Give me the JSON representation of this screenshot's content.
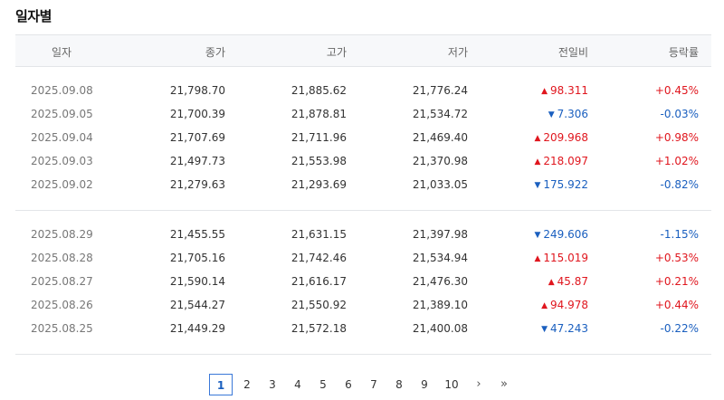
{
  "title": "일자별",
  "headers": [
    "일자",
    "종가",
    "고가",
    "저가",
    "전일비",
    "등락률"
  ],
  "groups": [
    [
      {
        "date": "2025.09.08",
        "close": "21,798.70",
        "high": "21,885.62",
        "low": "21,776.24",
        "change": "98.311",
        "dir": "up",
        "rate": "+0.45%"
      },
      {
        "date": "2025.09.05",
        "close": "21,700.39",
        "high": "21,878.81",
        "low": "21,534.72",
        "change": "7.306",
        "dir": "down",
        "rate": "-0.03%"
      },
      {
        "date": "2025.09.04",
        "close": "21,707.69",
        "high": "21,711.96",
        "low": "21,469.40",
        "change": "209.968",
        "dir": "up",
        "rate": "+0.98%"
      },
      {
        "date": "2025.09.03",
        "close": "21,497.73",
        "high": "21,553.98",
        "low": "21,370.98",
        "change": "218.097",
        "dir": "up",
        "rate": "+1.02%"
      },
      {
        "date": "2025.09.02",
        "close": "21,279.63",
        "high": "21,293.69",
        "low": "21,033.05",
        "change": "175.922",
        "dir": "down",
        "rate": "-0.82%"
      }
    ],
    [
      {
        "date": "2025.08.29",
        "close": "21,455.55",
        "high": "21,631.15",
        "low": "21,397.98",
        "change": "249.606",
        "dir": "down",
        "rate": "-1.15%"
      },
      {
        "date": "2025.08.28",
        "close": "21,705.16",
        "high": "21,742.46",
        "low": "21,534.94",
        "change": "115.019",
        "dir": "up",
        "rate": "+0.53%"
      },
      {
        "date": "2025.08.27",
        "close": "21,590.14",
        "high": "21,616.17",
        "low": "21,476.30",
        "change": "45.87",
        "dir": "up",
        "rate": "+0.21%"
      },
      {
        "date": "2025.08.26",
        "close": "21,544.27",
        "high": "21,550.92",
        "low": "21,389.10",
        "change": "94.978",
        "dir": "up",
        "rate": "+0.44%"
      },
      {
        "date": "2025.08.25",
        "close": "21,449.29",
        "high": "21,572.18",
        "low": "21,400.08",
        "change": "47.243",
        "dir": "down",
        "rate": "-0.22%"
      }
    ]
  ],
  "pagination": {
    "current": "1",
    "pages": [
      "1",
      "2",
      "3",
      "4",
      "5",
      "6",
      "7",
      "8",
      "9",
      "10"
    ],
    "next": "›",
    "last": "»"
  },
  "symbols": {
    "up": "▲",
    "down": "▼"
  },
  "colors": {
    "up": "#e0161e",
    "down": "#1a5fbf",
    "header_bg": "#f7f8fa",
    "active_page": "#3a78d8"
  }
}
